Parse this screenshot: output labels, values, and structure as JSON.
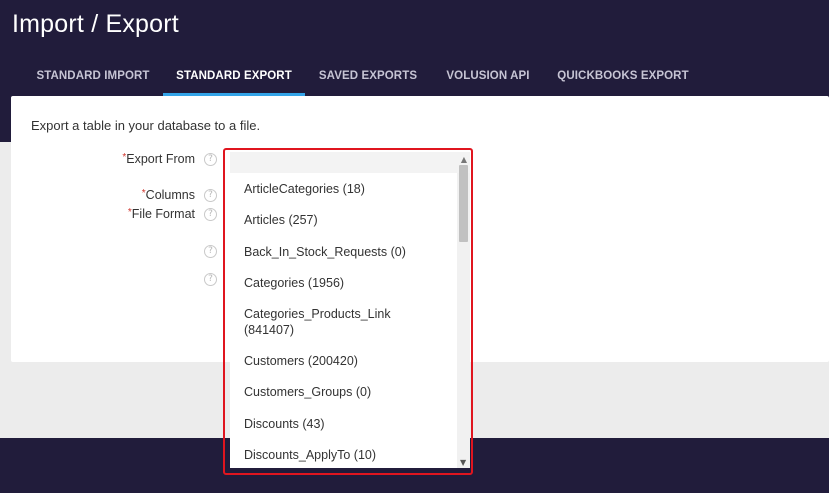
{
  "page": {
    "title": "Import / Export"
  },
  "tabs": [
    {
      "label": "STANDARD IMPORT",
      "active": false
    },
    {
      "label": "STANDARD EXPORT",
      "active": true
    },
    {
      "label": "SAVED EXPORTS",
      "active": false
    },
    {
      "label": "VOLUSION API",
      "active": false
    },
    {
      "label": "QUICKBOOKS EXPORT",
      "active": false
    }
  ],
  "form": {
    "description": "Export a table in your database to a file.",
    "required_marker": "*",
    "help_glyph": "?",
    "fields": {
      "export_from": {
        "label": "Export From",
        "value": ""
      },
      "columns": {
        "label": "Columns"
      },
      "file_format": {
        "label": "File Format"
      }
    }
  },
  "dropdown": {
    "scroll_up_glyph": "▲",
    "scroll_down_glyph": "▼",
    "options": [
      "ArticleCategories (18)",
      "Articles (257)",
      "Back_In_Stock_Requests (0)",
      "Categories (1956)",
      "Categories_Products_Link (841407)",
      "Customers (200420)",
      "Customers_Groups (0)",
      "Discounts (43)",
      "Discounts_ApplyTo (10)"
    ]
  },
  "colors": {
    "header_bg": "#211c3b",
    "active_tab_underline": "#33a4e8",
    "highlight_border": "#e0151f",
    "required_marker": "#d0332b"
  }
}
